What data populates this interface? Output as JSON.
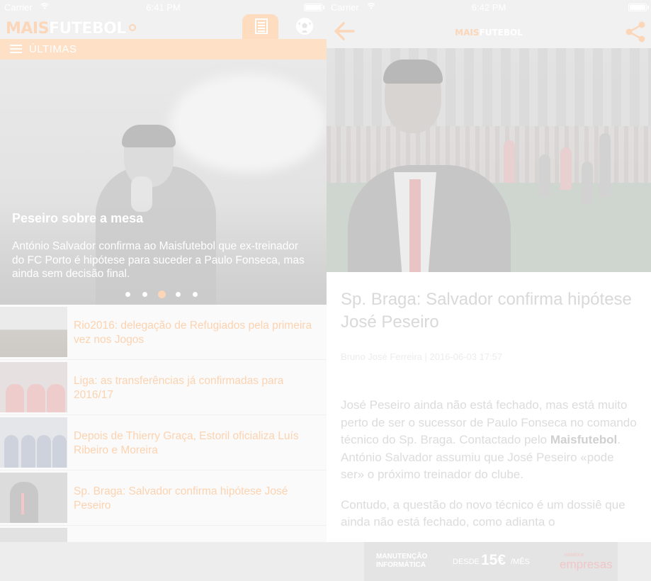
{
  "status_left": {
    "carrier": "Carrier",
    "time": "6:41 PM"
  },
  "status_right": {
    "carrier": "Carrier",
    "time": "6:42 PM"
  },
  "app": {
    "logo_part1": "MAIS",
    "logo_part2": "FUTEBOL",
    "tabs": [
      {
        "name": "news",
        "icon": "newspaper-icon",
        "active": true
      },
      {
        "name": "football",
        "icon": "soccer-ball-icon",
        "active": false
      }
    ],
    "section_title": "ÚLTIMAS",
    "accent_color": "#fbd6b8"
  },
  "hero": {
    "title": "Peseiro sobre a mesa",
    "summary": "António Salvador confirma ao Maisfutebol que ex-treinador do FC Porto é hipótese para suceder a Paulo Fonseca, mas ainda sem decisão final.",
    "page_count": 5,
    "active_page": 3
  },
  "news": [
    {
      "headline": "Rio2016: delegação de Refugiados pela primeira vez nos Jogos"
    },
    {
      "headline": "Liga: as transferências já confirmadas para 2016/17"
    },
    {
      "headline": "Depois de Thierry Graça, Estoril oficializa Luís Ribeiro e Moreira"
    },
    {
      "headline": "Sp. Braga: Salvador confirma hipótese José Peseiro"
    }
  ],
  "article": {
    "header_logo_part1": "MAIS",
    "header_logo_part2": "FUTEBOL",
    "title": "Sp. Braga: Salvador confirma hipótese José Peseiro",
    "byline": "Bruno José Ferreira | 2016-06-03 17:57",
    "p1_before": "José Peseiro ainda não está fechado, mas está muito perto de ser o sucessor de Paulo Fonseca no comando técnico do Sp. Braga. Contactado pelo ",
    "p1_bold": "Maisfutebol",
    "p1_after": ". António Salvador assumiu que José Peseiro «pode ser» o próximo treinador do clube.",
    "p2": "Contudo, a questão do novo técnico é um dossiê que ainda não está fechado, como adianta o"
  },
  "ad": {
    "line1": "MANUTENÇÃO",
    "line2": "INFORMÁTICA",
    "desde": "DESDE",
    "price": "15€",
    "per": "/MÊS",
    "brand_small": "vodafone",
    "brand": "empresas"
  }
}
